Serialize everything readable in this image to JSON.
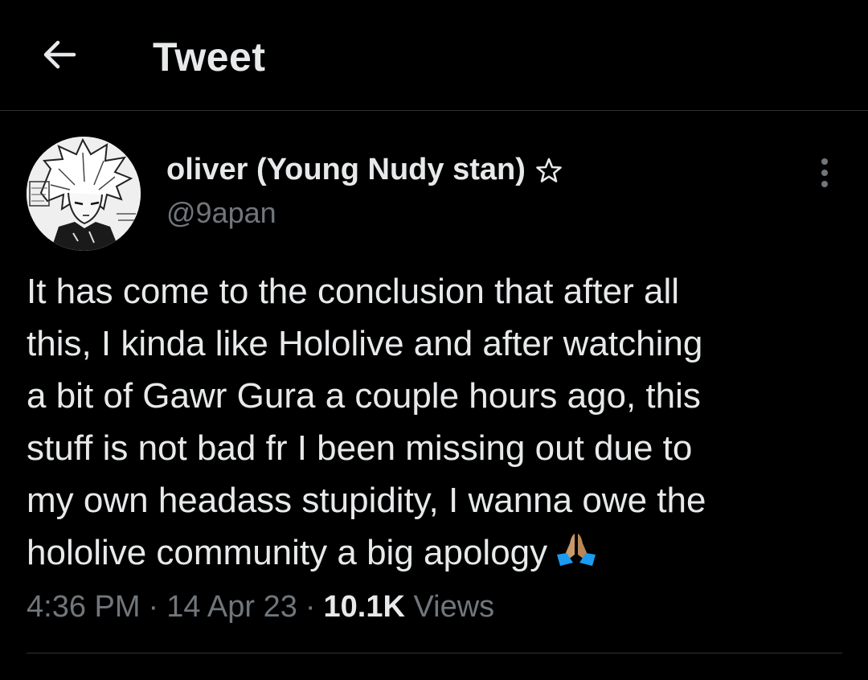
{
  "header": {
    "back_icon": "arrow-left-icon",
    "title": "Tweet"
  },
  "tweet": {
    "author": {
      "display_name": "oliver (Young Nudy stan)",
      "badge_icon": "star-icon",
      "handle": "@9apan",
      "avatar_icon": "manga-avatar"
    },
    "text_lines": [
      "It has come to the conclusion that after all",
      "this, I kinda like Hololive and after watching",
      "a bit of Gawr Gura a couple hours ago, this",
      "stuff is not bad fr I been missing out due to",
      "my own headass stupidity, I wanna owe the",
      "hololive community a big apology"
    ],
    "emoji_icon": "folded-hands-icon",
    "time": "4:36 PM",
    "date": "14 Apr 23",
    "separator": "·",
    "views_count": "10.1K",
    "views_label": "Views"
  },
  "colors": {
    "background": "#000000",
    "text_primary": "#e7e9ea",
    "text_secondary": "#71767b",
    "divider": "#2f3336"
  }
}
